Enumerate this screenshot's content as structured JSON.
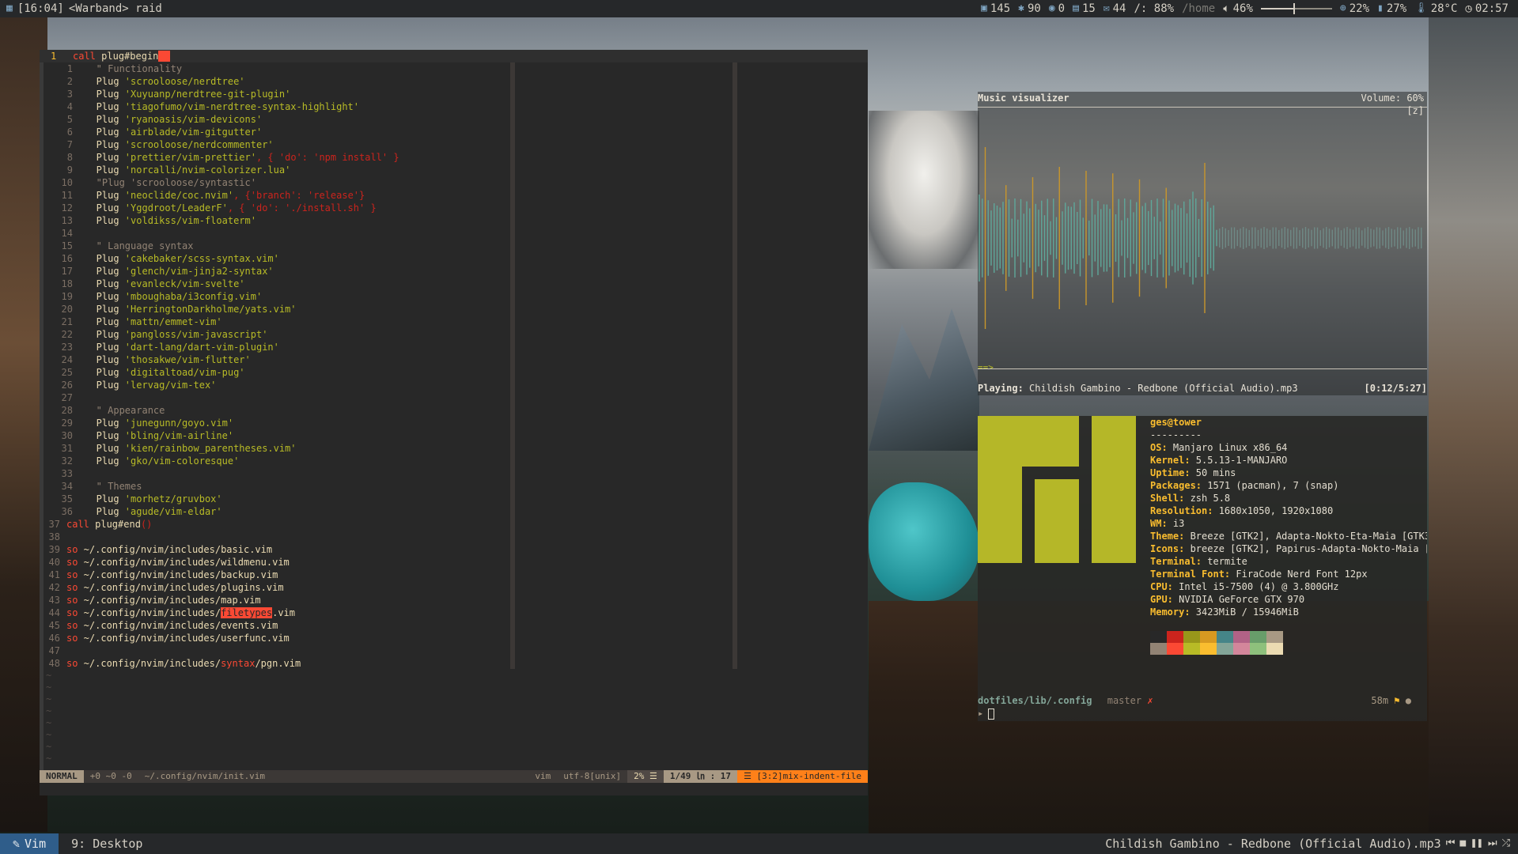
{
  "topbar": {
    "calendar_icon": "calendar-icon",
    "time_title": "[16:04]",
    "window_title": "<Warband> raid",
    "stats": [
      {
        "icon": "package-icon",
        "value": "145"
      },
      {
        "icon": "bug-icon",
        "value": "90"
      },
      {
        "icon": "github-icon",
        "value": "0"
      },
      {
        "icon": "inbox-icon",
        "value": "15"
      },
      {
        "icon": "mail-icon",
        "value": "44"
      }
    ],
    "disk_root": "/: 88%",
    "disk_home": "/home",
    "volume": "46%",
    "volume_level": 0.46,
    "cpu": "22%",
    "memory": "27%",
    "temp": "28°C",
    "clock": "02:57"
  },
  "vim": {
    "top_line_num": "1",
    "top_line_text": "call plug#begin",
    "lines": [
      {
        "n": "1",
        "t": "   \" Functionality",
        "c": "com"
      },
      {
        "n": "2",
        "pre": "   Plug ",
        "s": "'scrooloose/nerdtree'"
      },
      {
        "n": "3",
        "pre": "   Plug ",
        "s": "'Xuyuanp/nerdtree-git-plugin'"
      },
      {
        "n": "4",
        "pre": "   Plug ",
        "s": "'tiagofumo/vim-nerdtree-syntax-highlight'"
      },
      {
        "n": "5",
        "pre": "   Plug ",
        "s": "'ryanoasis/vim-devicons'"
      },
      {
        "n": "6",
        "pre": "   Plug ",
        "s": "'airblade/vim-gitgutter'"
      },
      {
        "n": "7",
        "pre": "   Plug ",
        "s": "'scrooloose/nerdcommenter'"
      },
      {
        "n": "8",
        "pre": "   Plug ",
        "s": "'prettier/vim-prettier'",
        "post": ", { 'do': 'npm install' }"
      },
      {
        "n": "9",
        "pre": "   Plug ",
        "s": "'norcalli/nvim-colorizer.lua'"
      },
      {
        "n": "10",
        "t": "   \"Plug 'scrooloose/syntastic'",
        "c": "com"
      },
      {
        "n": "11",
        "pre": "   Plug ",
        "s": "'neoclide/coc.nvim'",
        "post": ", {'branch': 'release'}"
      },
      {
        "n": "12",
        "pre": "   Plug ",
        "s": "'Yggdroot/LeaderF'",
        "post": ", { 'do': './install.sh' }"
      },
      {
        "n": "13",
        "pre": "   Plug ",
        "s": "'voldikss/vim-floaterm'"
      },
      {
        "n": "14",
        "t": ""
      },
      {
        "n": "15",
        "t": "   \" Language syntax",
        "c": "com"
      },
      {
        "n": "16",
        "pre": "   Plug ",
        "s": "'cakebaker/scss-syntax.vim'"
      },
      {
        "n": "17",
        "pre": "   Plug ",
        "s": "'glench/vim-jinja2-syntax'"
      },
      {
        "n": "18",
        "pre": "   Plug ",
        "s": "'evanleck/vim-svelte'"
      },
      {
        "n": "19",
        "pre": "   Plug ",
        "s": "'mboughaba/i3config.vim'"
      },
      {
        "n": "20",
        "pre": "   Plug ",
        "s": "'HerringtonDarkholme/yats.vim'"
      },
      {
        "n": "21",
        "pre": "   Plug ",
        "s": "'mattn/emmet-vim'"
      },
      {
        "n": "22",
        "pre": "   Plug ",
        "s": "'pangloss/vim-javascript'"
      },
      {
        "n": "23",
        "pre": "   Plug ",
        "s": "'dart-lang/dart-vim-plugin'"
      },
      {
        "n": "24",
        "pre": "   Plug ",
        "s": "'thosakwe/vim-flutter'"
      },
      {
        "n": "25",
        "pre": "   Plug ",
        "s": "'digitaltoad/vim-pug'"
      },
      {
        "n": "26",
        "pre": "   Plug ",
        "s": "'lervag/vim-tex'"
      },
      {
        "n": "27",
        "t": ""
      },
      {
        "n": "28",
        "t": "   \" Appearance",
        "c": "com"
      },
      {
        "n": "29",
        "pre": "   Plug ",
        "s": "'junegunn/goyo.vim'"
      },
      {
        "n": "30",
        "pre": "   Plug ",
        "s": "'bling/vim-airline'"
      },
      {
        "n": "31",
        "pre": "   Plug ",
        "s": "'kien/rainbow_parentheses.vim'"
      },
      {
        "n": "32",
        "pre": "   Plug ",
        "s": "'gko/vim-coloresque'"
      },
      {
        "n": "33",
        "t": ""
      },
      {
        "n": "34",
        "t": "   \" Themes",
        "c": "com"
      },
      {
        "n": "35",
        "pre": "   Plug ",
        "s": "'morhetz/gruvbox'"
      },
      {
        "n": "36",
        "pre": "   Plug ",
        "s": "'agude/vim-eldar'"
      },
      {
        "n": "37",
        "kw": "call",
        "rest": " plug#end",
        "post": "()",
        "main": true
      },
      {
        "n": "38",
        "t": "",
        "main": true
      },
      {
        "n": "39",
        "kw": "so",
        "rest": " ~/.config/nvim/includes/basic.vim",
        "main": true
      },
      {
        "n": "40",
        "kw": "so",
        "rest": " ~/.config/nvim/includes/wildmenu.vim",
        "main": true
      },
      {
        "n": "41",
        "kw": "so",
        "rest": " ~/.config/nvim/includes/backup.vim",
        "main": true
      },
      {
        "n": "42",
        "kw": "so",
        "rest": " ~/.config/nvim/includes/plugins.vim",
        "main": true
      },
      {
        "n": "43",
        "kw": "so",
        "rest": " ~/.config/nvim/includes/map.vim",
        "main": true
      },
      {
        "n": "44",
        "kw": "so",
        "rest": " ~/.config/nvim/includes/",
        "hl": "filetypes",
        "after": ".vim",
        "main": true
      },
      {
        "n": "45",
        "kw": "so",
        "rest": " ~/.config/nvim/includes/events.vim",
        "main": true
      },
      {
        "n": "46",
        "kw": "so",
        "rest": " ~/.config/nvim/includes/userfunc.vim",
        "main": true
      },
      {
        "n": "47",
        "t": "",
        "main": true
      },
      {
        "n": "48",
        "kw": "so",
        "rest": " ~/.config/nvim/includes/",
        "syn": "syntax",
        "after": "/pgn.vim",
        "main": true
      }
    ],
    "tilde_count": 8,
    "status": {
      "mode": "NORMAL",
      "git": "+0 ~0 -0",
      "file": "~/.config/nvim/init.vim",
      "filetype": "vim",
      "encoding": "utf-8[unix]",
      "percent": "2% ☰",
      "position": "1/49 ㏑ : 17",
      "warning": "☰ [3:2]mix-indent-file"
    }
  },
  "music": {
    "title": "Music visualizer",
    "volume": "Volume: 60%",
    "z_key": "[z]",
    "arrow": "==>",
    "playing_label": "Playing:",
    "track": "Childish Gambino - Redbone (Official Audio).mp3",
    "time": "[0:12/5:27]",
    "bar_colors": {
      "teal": "#5fa89a",
      "amber": "#c8962c",
      "grey": "#6f8a86"
    }
  },
  "neofetch": {
    "user": "ges@tower",
    "sep": "---------",
    "rows": [
      {
        "k": "OS:",
        "v": " Manjaro Linux x86_64"
      },
      {
        "k": "Kernel:",
        "v": " 5.5.13-1-MANJARO"
      },
      {
        "k": "Uptime:",
        "v": " 50 mins"
      },
      {
        "k": "Packages:",
        "v": " 1571 (pacman), 7 (snap)"
      },
      {
        "k": "Shell:",
        "v": " zsh 5.8"
      },
      {
        "k": "Resolution:",
        "v": " 1680x1050, 1920x1080"
      },
      {
        "k": "WM:",
        "v": " i3"
      },
      {
        "k": "Theme:",
        "v": " Breeze [GTK2], Adapta-Nokto-Eta-Maia [GTK3"
      },
      {
        "k": "Icons:",
        "v": " breeze [GTK2], Papirus-Adapta-Nokto-Maia ["
      },
      {
        "k": "Terminal:",
        "v": " termite"
      },
      {
        "k": "Terminal Font:",
        "v": " FiraCode Nerd Font 12px"
      },
      {
        "k": "CPU:",
        "v": " Intel i5-7500 (4) @ 3.800GHz"
      },
      {
        "k": "GPU:",
        "v": " NVIDIA GeForce GTX 970"
      },
      {
        "k": "Memory:",
        "v": " 3423MiB / 15946MiB"
      }
    ],
    "swatches": [
      "#282828",
      "#cc241d",
      "#98971a",
      "#d79921",
      "#458588",
      "#b16286",
      "#689d6a",
      "#a89984",
      "#928374",
      "#fb4934",
      "#b8bb26",
      "#fabd2f",
      "#83a598",
      "#d3869b",
      "#8ec07c",
      "#ebdbb2"
    ],
    "logo_color": "#b5b728",
    "prompt": {
      "path": "dotfiles/lib/.config",
      "branch": "master",
      "dirty": "✗",
      "elapsed": "58m",
      "flag": "⚑",
      "dot": "●",
      "caret": "▸"
    }
  },
  "bottombar": {
    "workspace_active": "Vim",
    "workspace_other": "9: Desktop",
    "now_playing": "Childish Gambino - Redbone (Official Audio).mp3",
    "controls": [
      "⏮",
      "■",
      "❚❚",
      "⏭",
      "⤮"
    ]
  }
}
